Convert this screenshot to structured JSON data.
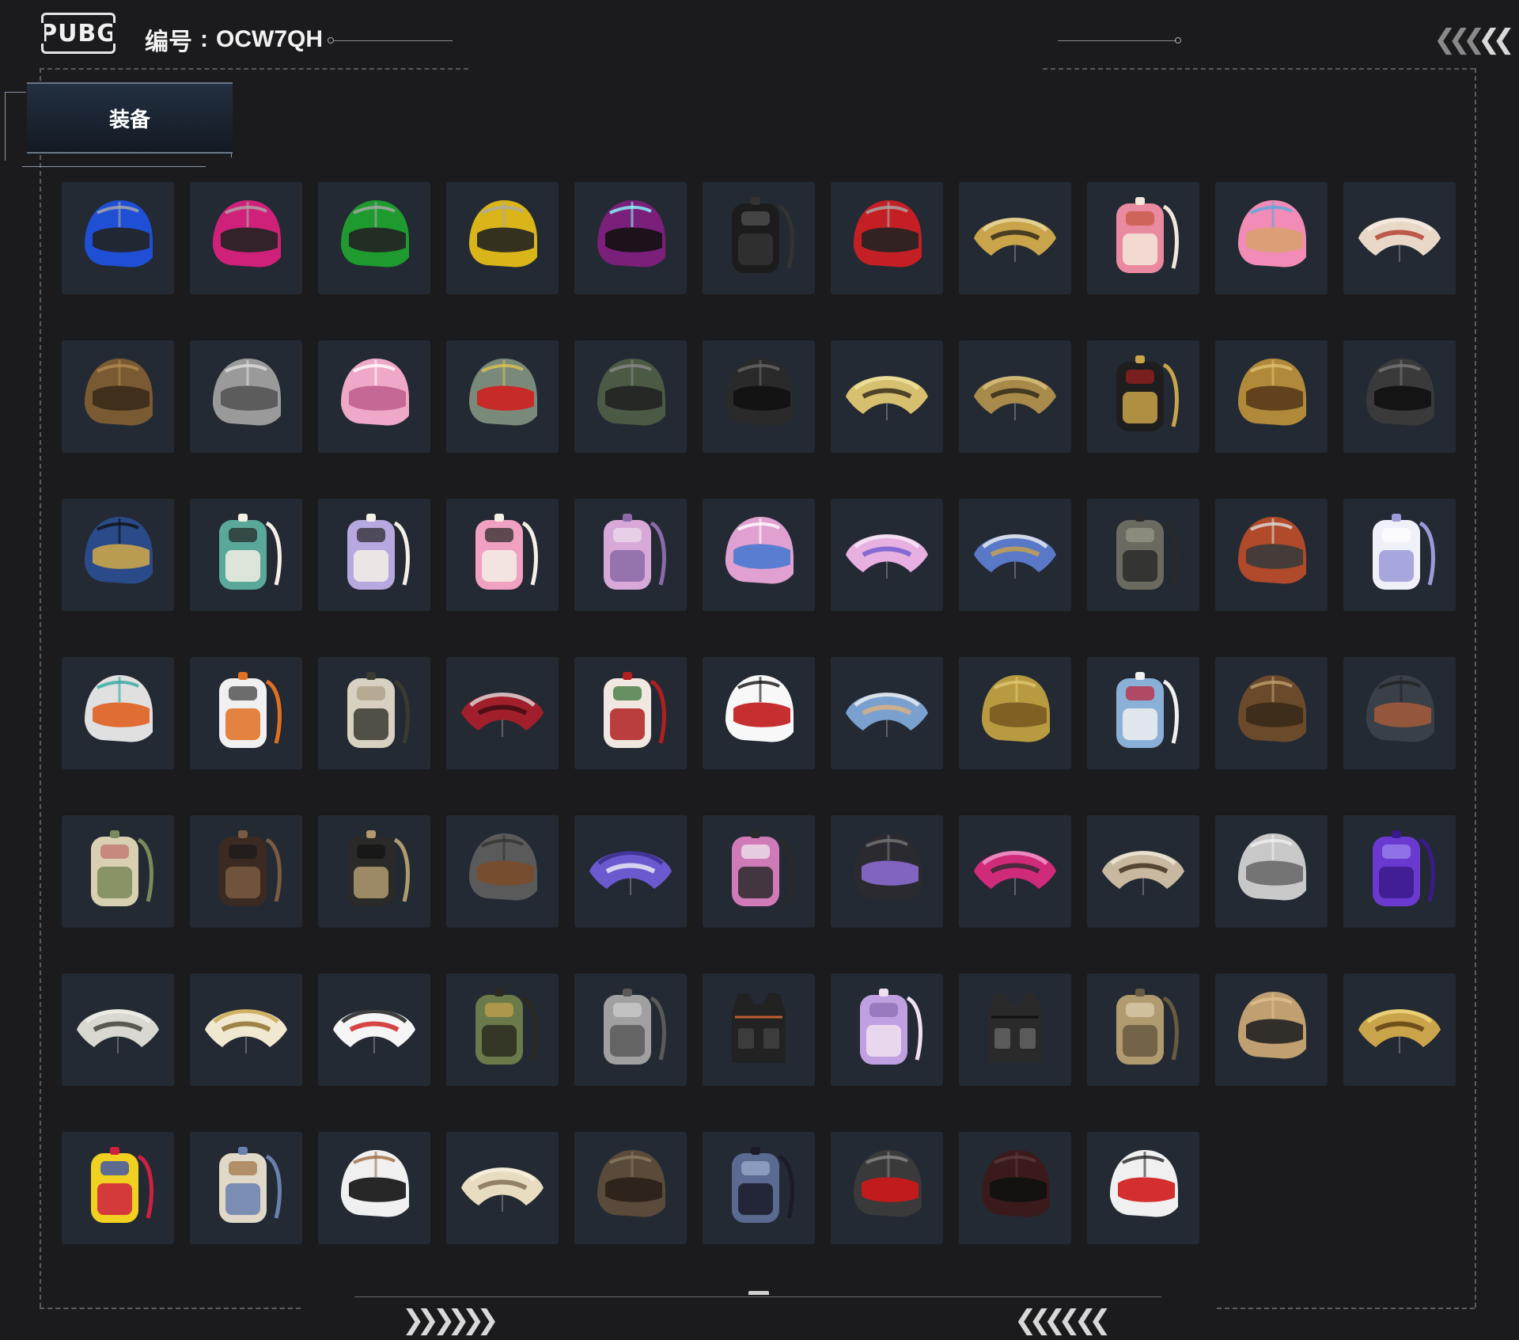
{
  "header": {
    "logo_text": "PUBG",
    "serial_label": "编号",
    "serial_sep": ":",
    "serial_value": "OCW7QH"
  },
  "tabs": [
    {
      "label": "装备",
      "active": true
    }
  ],
  "colors": {
    "background": "#1b1b1d",
    "card": "#232a33",
    "tab_top": "#233041"
  },
  "items": [
    {
      "name": "helmet-blue-racing",
      "type": "helmet",
      "colors": [
        "#1e4fd4",
        "#222",
        "#aaa"
      ]
    },
    {
      "name": "helmet-pink-racing",
      "type": "helmet",
      "colors": [
        "#d0217a",
        "#222",
        "#aaa"
      ]
    },
    {
      "name": "helmet-green-racing",
      "type": "helmet",
      "colors": [
        "#1e9a2e",
        "#222",
        "#aaa"
      ]
    },
    {
      "name": "helmet-yellow-racing",
      "type": "helmet",
      "colors": [
        "#d9b51a",
        "#222",
        "#aaa"
      ]
    },
    {
      "name": "helmet-purple-cat",
      "type": "helmet",
      "colors": [
        "#7a1f7a",
        "#111",
        "#8ff"
      ]
    },
    {
      "name": "backpack-black",
      "type": "backpack",
      "colors": [
        "#1c1c1c",
        "#333",
        "#555"
      ]
    },
    {
      "name": "helmet-red-racing",
      "type": "helmet",
      "colors": [
        "#c41f24",
        "#222",
        "#aaa"
      ]
    },
    {
      "name": "parachute-gold-black",
      "type": "parachute",
      "colors": [
        "#c9a44a",
        "#2a2418",
        "#e8d8a0"
      ]
    },
    {
      "name": "backpack-donut",
      "type": "backpack",
      "colors": [
        "#e98aa0",
        "#f3e6da",
        "#c2553a"
      ]
    },
    {
      "name": "helmet-pink-icecream",
      "type": "helmet",
      "colors": [
        "#f28bb6",
        "#d8a070",
        "#5ad"
      ]
    },
    {
      "name": "parachute-red-white",
      "type": "parachute",
      "colors": [
        "#e9d8c8",
        "#b23a2a",
        "#f5eee6"
      ]
    },
    {
      "name": "helmet-brown-camo",
      "type": "helmet",
      "colors": [
        "#7a5a32",
        "#3a2a18",
        "#b08a50"
      ]
    },
    {
      "name": "helmet-grey-bear",
      "type": "helmet",
      "colors": [
        "#9a9a9a",
        "#555",
        "#ddd"
      ]
    },
    {
      "name": "helmet-pink-bunny",
      "type": "helmet",
      "colors": [
        "#f0a8c8",
        "#c06090",
        "#fff"
      ]
    },
    {
      "name": "helmet-devil-horns",
      "type": "helmet",
      "colors": [
        "#7a8a7a",
        "#d01f1f",
        "#e0c050"
      ]
    },
    {
      "name": "helmet-goggles-green",
      "type": "helmet",
      "colors": [
        "#4a5a44",
        "#222",
        "#888"
      ]
    },
    {
      "name": "helmet-black-moto",
      "type": "helmet",
      "colors": [
        "#2a2a2a",
        "#111",
        "#666"
      ]
    },
    {
      "name": "parachute-gold-35",
      "type": "parachute",
      "colors": [
        "#d6c070",
        "#2a2418",
        "#f0e2a0"
      ]
    },
    {
      "name": "parachute-gold-pattern",
      "type": "parachute",
      "colors": [
        "#a88a4a",
        "#2a2418",
        "#d8c080"
      ]
    },
    {
      "name": "backpack-black-gold",
      "type": "backpack",
      "colors": [
        "#1e1e1e",
        "#c9a44a",
        "#a02020"
      ]
    },
    {
      "name": "helmet-gold-visor",
      "type": "helmet",
      "colors": [
        "#b08a3a",
        "#5a3a1a",
        "#e0c070"
      ]
    },
    {
      "name": "helmet-dark-ops",
      "type": "helmet",
      "colors": [
        "#3a3a3a",
        "#111",
        "#777"
      ]
    },
    {
      "name": "helmet-blue-gold",
      "type": "helmet",
      "colors": [
        "#2a4a8a",
        "#c9a44a",
        "#111"
      ]
    },
    {
      "name": "backpack-panda-teal",
      "type": "backpack",
      "colors": [
        "#5aa89a",
        "#f5f0e6",
        "#222"
      ]
    },
    {
      "name": "backpack-panda-lavender",
      "type": "backpack",
      "colors": [
        "#b8a8e0",
        "#f5f0e6",
        "#222"
      ]
    },
    {
      "name": "backpack-panda-pink",
      "type": "backpack",
      "colors": [
        "#f0a0c0",
        "#f5f0e6",
        "#222"
      ]
    },
    {
      "name": "backpack-pink-k",
      "type": "backpack",
      "colors": [
        "#d8a8d8",
        "#8a6aa8",
        "#f0e0f0"
      ]
    },
    {
      "name": "helmet-pink-horns-k",
      "type": "helmet",
      "colors": [
        "#e0a0d0",
        "#4a7ad0",
        "#fff"
      ]
    },
    {
      "name": "parachute-pink-script",
      "type": "parachute",
      "colors": [
        "#e8b0e0",
        "#6a5ad0",
        "#f8e8f8"
      ]
    },
    {
      "name": "parachute-blue-gold",
      "type": "parachute",
      "colors": [
        "#5a78c8",
        "#c9a44a",
        "#f0f0f0"
      ]
    },
    {
      "name": "backpack-camo-grey",
      "type": "backpack",
      "colors": [
        "#6a6a60",
        "#2a2a2a",
        "#9a9a8a"
      ]
    },
    {
      "name": "helmet-red-camo",
      "type": "helmet",
      "colors": [
        "#b04a2a",
        "#3a3a3a",
        "#ddd"
      ]
    },
    {
      "name": "backpack-white-s",
      "type": "backpack",
      "colors": [
        "#f0f0f8",
        "#9a9ad8",
        "#fff"
      ]
    },
    {
      "name": "helmet-orange-visor",
      "type": "helmet",
      "colors": [
        "#e0e0e0",
        "#e06020",
        "#30a8a0"
      ]
    },
    {
      "name": "backpack-white-orange",
      "type": "backpack",
      "colors": [
        "#f0f0f0",
        "#e07020",
        "#333"
      ]
    },
    {
      "name": "backpack-beige",
      "type": "backpack",
      "colors": [
        "#d8d0c0",
        "#3a3a30",
        "#a89a80"
      ]
    },
    {
      "name": "parachute-red-logo",
      "type": "parachute",
      "colors": [
        "#a01f2a",
        "#3a0a10",
        "#ddd"
      ]
    },
    {
      "name": "backpack-red-white-knit",
      "type": "backpack",
      "colors": [
        "#f0e8e0",
        "#b02020",
        "#2a6a2a"
      ]
    },
    {
      "name": "helmet-snowman-tophat",
      "type": "helmet",
      "colors": [
        "#f8f8f8",
        "#c01818",
        "#111"
      ]
    },
    {
      "name": "parachute-blue-sunset",
      "type": "parachute",
      "colors": [
        "#7aa0d0",
        "#e0b080",
        "#f0f0f0"
      ]
    },
    {
      "name": "helmet-gold-winged",
      "type": "helmet",
      "colors": [
        "#b89a40",
        "#7a5a20",
        "#e0c870"
      ]
    },
    {
      "name": "backpack-shark",
      "type": "backpack",
      "colors": [
        "#8ab0d8",
        "#f0f0f0",
        "#c02030"
      ]
    },
    {
      "name": "helmet-viking-bronze",
      "type": "helmet",
      "colors": [
        "#6a4a2a",
        "#3a2a18",
        "#c0a070"
      ]
    },
    {
      "name": "helmet-spiked-dark",
      "type": "helmet",
      "colors": [
        "#3a4048",
        "#a05a3a",
        "#222"
      ]
    },
    {
      "name": "backpack-floral-camo",
      "type": "backpack",
      "colors": [
        "#d8d0b0",
        "#7a8a5a",
        "#c06a6a"
      ]
    },
    {
      "name": "backpack-dark-floral",
      "type": "backpack",
      "colors": [
        "#3a2a22",
        "#7a5a40",
        "#1a1a1a"
      ]
    },
    {
      "name": "backpack-black-51",
      "type": "backpack",
      "colors": [
        "#2a2a28",
        "#b09a70",
        "#111"
      ]
    },
    {
      "name": "helmet-grey-camo",
      "type": "helmet",
      "colors": [
        "#5a5a5a",
        "#7a4a2a",
        "#333"
      ]
    },
    {
      "name": "parachute-purple-print",
      "type": "parachute",
      "colors": [
        "#6a5ad0",
        "#f0f0f8",
        "#3a2a8a"
      ]
    },
    {
      "name": "backpack-pink-drip",
      "type": "backpack",
      "colors": [
        "#d07ab8",
        "#2a2a2a",
        "#f0f0f0"
      ]
    },
    {
      "name": "helmet-horns-cloud",
      "type": "helmet",
      "colors": [
        "#2a2a30",
        "#8a6ad0",
        "#777"
      ]
    },
    {
      "name": "parachute-pink-graffiti",
      "type": "parachute",
      "colors": [
        "#d02a7a",
        "#2a2a30",
        "#f0a0d0"
      ]
    },
    {
      "name": "parachute-beige-feather",
      "type": "parachute",
      "colors": [
        "#c8b8a0",
        "#3a2a1a",
        "#f0e8d8"
      ]
    },
    {
      "name": "helmet-silver-horns",
      "type": "helmet",
      "colors": [
        "#c8c8c8",
        "#6a6a6a",
        "#f0f0f0"
      ]
    },
    {
      "name": "backpack-purple",
      "type": "backpack",
      "colors": [
        "#6a3ad0",
        "#3a1a8a",
        "#a08af0"
      ]
    },
    {
      "name": "parachute-leopard",
      "type": "parachute",
      "colors": [
        "#d8d8d0",
        "#3a3a30",
        "#f0f0e8"
      ]
    },
    {
      "name": "parachute-gold-emblem",
      "type": "parachute",
      "colors": [
        "#f0e8d0",
        "#8a6a20",
        "#c9a44a"
      ]
    },
    {
      "name": "parachute-kfc",
      "type": "parachute",
      "colors": [
        "#f5f5f5",
        "#d01818",
        "#111"
      ]
    },
    {
      "name": "backpack-olive-tactical",
      "type": "backpack",
      "colors": [
        "#6a7a4a",
        "#2a2a20",
        "#c9a44a"
      ]
    },
    {
      "name": "backpack-grey-stone",
      "type": "backpack",
      "colors": [
        "#a0a0a0",
        "#5a5a5a",
        "#d0d0d0"
      ]
    },
    {
      "name": "vest-black-orange",
      "type": "vest",
      "colors": [
        "#222",
        "#c06030",
        "#444"
      ]
    },
    {
      "name": "backpack-lilac-cartoon",
      "type": "backpack",
      "colors": [
        "#c0a0e0",
        "#f0e0f0",
        "#8a6ab0"
      ]
    },
    {
      "name": "vest-black-tactical",
      "type": "vest",
      "colors": [
        "#2a2a2a",
        "#111",
        "#666"
      ]
    },
    {
      "name": "backpack-tan-6",
      "type": "backpack",
      "colors": [
        "#b09a70",
        "#6a5a40",
        "#e0d0b0"
      ]
    },
    {
      "name": "helmet-tan-goggle",
      "type": "helmet",
      "colors": [
        "#c0a070",
        "#222",
        "#e0c090"
      ]
    },
    {
      "name": "parachute-gold-ornate",
      "type": "parachute",
      "colors": [
        "#c9a44a",
        "#5a3a10",
        "#f0d880"
      ]
    },
    {
      "name": "backpack-yellow-red-blue",
      "type": "backpack",
      "colors": [
        "#f0d020",
        "#d02040",
        "#2040c0"
      ]
    },
    {
      "name": "backpack-knit-stripe",
      "type": "backpack",
      "colors": [
        "#e0d8c8",
        "#6a80b0",
        "#a07040"
      ]
    },
    {
      "name": "helmet-white-aviator",
      "type": "helmet",
      "colors": [
        "#f0f0f0",
        "#111",
        "#a06a40"
      ]
    },
    {
      "name": "parachute-cream-text",
      "type": "parachute",
      "colors": [
        "#e8dcc0",
        "#7a6a50",
        "#f8f0e0"
      ]
    },
    {
      "name": "helmet-brown-plaid",
      "type": "helmet",
      "colors": [
        "#5a4a3a",
        "#2a2018",
        "#8a7a60"
      ]
    },
    {
      "name": "backpack-blue-metal",
      "type": "backpack",
      "colors": [
        "#5a6a90",
        "#1a1a28",
        "#a0b0d0"
      ]
    },
    {
      "name": "helmet-spiked-red-visor",
      "type": "helmet",
      "colors": [
        "#3a3a3a",
        "#d01818",
        "#888"
      ]
    },
    {
      "name": "helmet-dark-red",
      "type": "helmet",
      "colors": [
        "#3a1a1a",
        "#111",
        "#5a3a3a"
      ]
    },
    {
      "name": "helmet-jester",
      "type": "helmet",
      "colors": [
        "#f0f0f0",
        "#d01818",
        "#222"
      ]
    }
  ]
}
